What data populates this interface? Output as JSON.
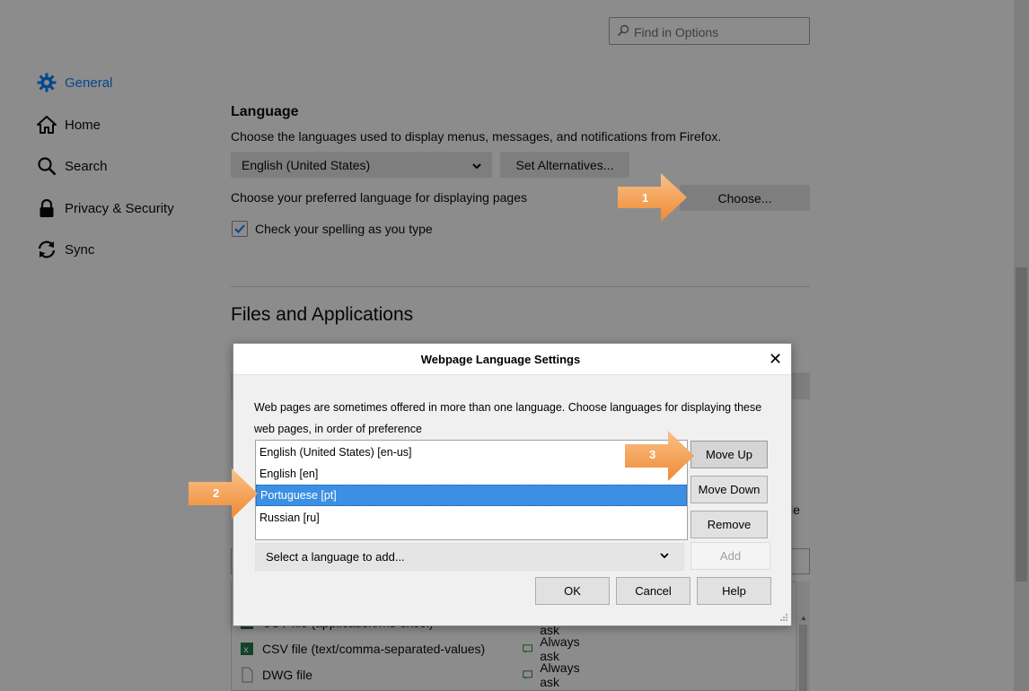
{
  "search": {
    "placeholder": "Find in Options"
  },
  "sidebar": {
    "items": [
      {
        "label": "General",
        "icon": "gear-icon"
      },
      {
        "label": "Home",
        "icon": "home-icon"
      },
      {
        "label": "Search",
        "icon": "search-icon"
      },
      {
        "label": "Privacy & Security",
        "icon": "lock-icon"
      },
      {
        "label": "Sync",
        "icon": "sync-icon"
      }
    ]
  },
  "language": {
    "heading": "Language",
    "description": "Choose the languages used to display menus, messages, and notifications from Firefox.",
    "ui_language": "English (United States)",
    "set_alternatives": "Set Alternatives...",
    "preferred_label": "Choose your preferred language for displaying pages",
    "choose_button": "Choose...",
    "spellcheck_label": "Check your spelling as you type",
    "spellcheck_checked": true
  },
  "files": {
    "heading": "Files and Applications",
    "partial_trailing": "le",
    "rows": [
      {
        "type": "CSV file (application/ms-excel)",
        "action": "Always ask"
      },
      {
        "type": "CSV file (text/comma-separated-values)",
        "action": "Always ask"
      },
      {
        "type": "DWG file",
        "action": "Always ask"
      }
    ]
  },
  "dialog": {
    "title": "Webpage Language Settings",
    "description": "Web pages are sometimes offered in more than one language. Choose languages for displaying these web pages, in order of preference",
    "languages": [
      "English (United States) [en-us]",
      "English [en]",
      "Portuguese [pt]",
      "Russian [ru]"
    ],
    "selected_language": "Portuguese [pt]",
    "move_up": "Move Up",
    "move_down": "Move Down",
    "remove": "Remove",
    "add_placeholder": "Select a language to add...",
    "add": "Add",
    "ok": "OK",
    "cancel": "Cancel",
    "help": "Help"
  },
  "callouts": [
    "1",
    "2",
    "3"
  ],
  "colors": {
    "accent": "#0a84ff",
    "selection": "#3c8fe3",
    "callout": "#f4a259"
  }
}
